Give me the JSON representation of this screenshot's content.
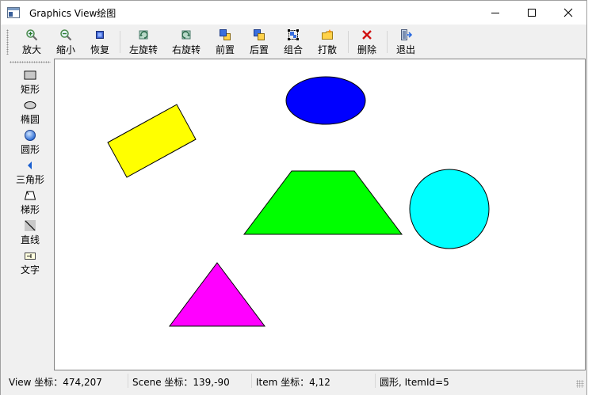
{
  "window": {
    "title": "Graphics  View绘图"
  },
  "toolbar": {
    "items": [
      {
        "label": "放大",
        "icon": "zoom-in-icon"
      },
      {
        "label": "缩小",
        "icon": "zoom-out-icon"
      },
      {
        "label": "恢复",
        "icon": "restore-icon"
      },
      {
        "label": "左旋转",
        "icon": "rotate-left-icon"
      },
      {
        "label": "右旋转",
        "icon": "rotate-right-icon"
      },
      {
        "label": "前置",
        "icon": "bring-front-icon"
      },
      {
        "label": "后置",
        "icon": "send-back-icon"
      },
      {
        "label": "组合",
        "icon": "group-icon"
      },
      {
        "label": "打散",
        "icon": "ungroup-icon"
      },
      {
        "label": "删除",
        "icon": "delete-icon"
      },
      {
        "label": "退出",
        "icon": "exit-icon"
      }
    ]
  },
  "shapes_toolbar": {
    "items": [
      {
        "label": "矩形",
        "icon": "rectangle-icon"
      },
      {
        "label": "椭圆",
        "icon": "ellipse-icon"
      },
      {
        "label": "圆形",
        "icon": "circle-icon"
      },
      {
        "label": "三角形",
        "icon": "triangle-icon"
      },
      {
        "label": "梯形",
        "icon": "trapezoid-icon"
      },
      {
        "label": "直线",
        "icon": "line-icon"
      },
      {
        "label": "文字",
        "icon": "text-icon"
      }
    ]
  },
  "scene": {
    "colors": {
      "rectangle": "#ffff00",
      "ellipse": "#0000ff",
      "trapezoid": "#00ff00",
      "circle": "#00ffff",
      "triangle": "#ff00ff",
      "outline": "#000000"
    }
  },
  "status": {
    "view": "View 坐标：474,207",
    "scene": "Scene 坐标：139,-90",
    "item": "Item 坐标：4,12",
    "info": "圆形, ItemId=5"
  }
}
